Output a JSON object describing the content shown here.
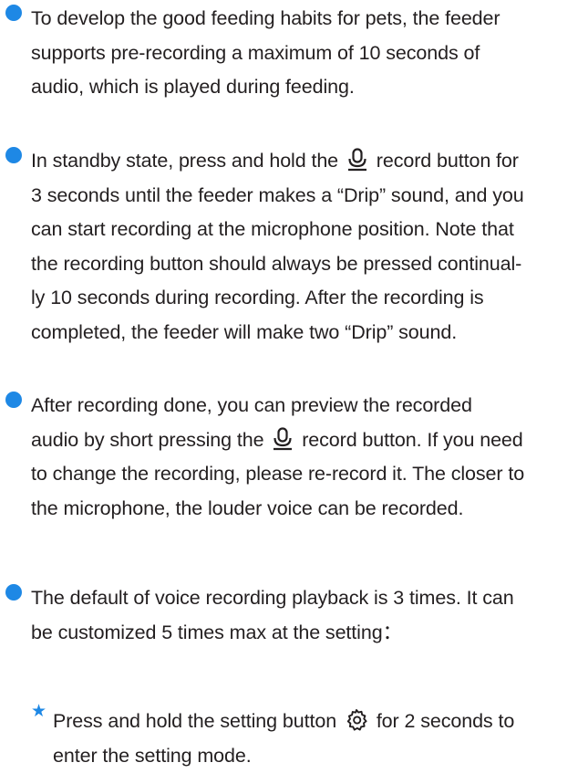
{
  "bullets": [
    {
      "lines": [
        "To develop the good feeding habits for pets, the feeder",
        "supports pre-recording a maximum of 10 seconds of",
        "audio, which is played during feeding."
      ]
    },
    {
      "line1_before_icon": "In standby state, press and hold the",
      "line1_after_icon": "record button for",
      "icon": "microphone-icon",
      "lines": [
        "3 seconds until the feeder makes a “Drip” sound, and you",
        "can start recording at the microphone position. Note that",
        "the recording button should always be pressed continual-",
        "ly 10 seconds during recording. After the recording is",
        "completed, the feeder will make two “Drip” sound."
      ]
    },
    {
      "lines_before": [
        "After recording done, you can preview the recorded"
      ],
      "line2_before_icon": "audio by short pressing the",
      "line2_after_icon": "record button. If you need",
      "icon": "microphone-icon",
      "lines": [
        "to change the recording, please re-record it. The closer to",
        "the microphone, the louder voice can be recorded."
      ]
    },
    {
      "lines": [
        "The default of voice recording playback is 3 times. It can",
        "be customized 5 times max at the setting："
      ]
    }
  ],
  "sub_bullet": {
    "marker": "★",
    "line1_before_icon": "Press and hold the setting button",
    "line1_after_icon": "for 2 seconds to",
    "icon": "gear-icon",
    "lines": [
      "enter the setting mode."
    ]
  },
  "colors": {
    "bullet": "#1e88e5",
    "text": "#231f20"
  }
}
